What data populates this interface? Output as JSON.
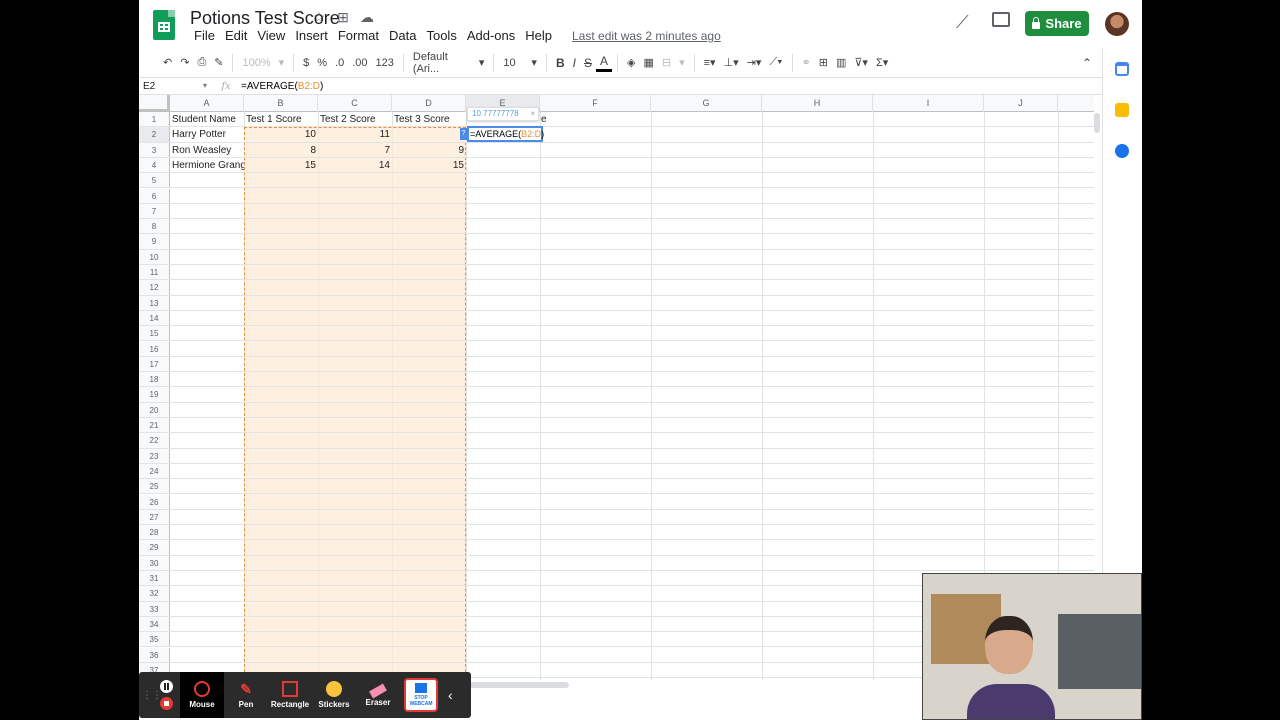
{
  "document": {
    "title": "Potions Test Score",
    "last_edit": "Last edit was 2 minutes ago"
  },
  "menu": [
    "File",
    "Edit",
    "View",
    "Insert",
    "Format",
    "Data",
    "Tools",
    "Add-ons",
    "Help"
  ],
  "share_label": "Share",
  "toolbar": {
    "zoom": "100%",
    "currency": "$",
    "percent": "%",
    "decimal_less": ".0",
    "decimal_more": ".00",
    "format_more": "123",
    "font": "Default (Ari...",
    "font_size": "10",
    "bold": "B",
    "italic": "I",
    "strike": "S",
    "text_color": "A"
  },
  "formula_bar": {
    "cell_ref": "E2",
    "fx": "fx",
    "formula_prefix": "=AVERAGE(",
    "formula_range": "B2:D",
    "formula_suffix": ")"
  },
  "columns": [
    "A",
    "B",
    "C",
    "D",
    "E",
    "F",
    "G",
    "H",
    "I",
    "J"
  ],
  "header_row": {
    "A": "Student Name",
    "B": "Test 1 Score",
    "C": "Test 2 Score",
    "D": "Test 3 Score",
    "E_suffix": "e"
  },
  "rows": [
    {
      "name": "Harry Potter",
      "t1": "10",
      "t2": "11",
      "t3": ""
    },
    {
      "name": "Ron Weasley",
      "t1": "8",
      "t2": "7",
      "t3": "9"
    },
    {
      "name": "Hermione Granger",
      "t1": "15",
      "t2": "14",
      "t3": "15"
    }
  ],
  "row_numbers": [
    "1",
    "2",
    "3",
    "4",
    "5",
    "6",
    "7",
    "8",
    "9",
    "10",
    "11",
    "12",
    "13",
    "14",
    "15",
    "16",
    "17",
    "18",
    "19",
    "20",
    "21",
    "22",
    "23",
    "24",
    "25",
    "26",
    "27",
    "28",
    "29",
    "30",
    "31",
    "32",
    "33",
    "34",
    "35",
    "36",
    "37"
  ],
  "edit_cell": {
    "tooltip_value": "10.77777778",
    "tooltip_close": "×",
    "tag": "?",
    "formula_prefix": "=AVERAGE(",
    "formula_range": "B2:D",
    "formula_suffix": ")"
  },
  "recorder": {
    "tools": [
      "Mouse",
      "Pen",
      "Rectangle",
      "Stickers",
      "Eraser"
    ],
    "stop_webcam": "STOP WEBCAM"
  },
  "colors": {
    "share_green": "#1e8e3e",
    "sheets_green": "#0f9d58",
    "range_orange": "#e69138",
    "active_blue": "#4a8ce7"
  }
}
